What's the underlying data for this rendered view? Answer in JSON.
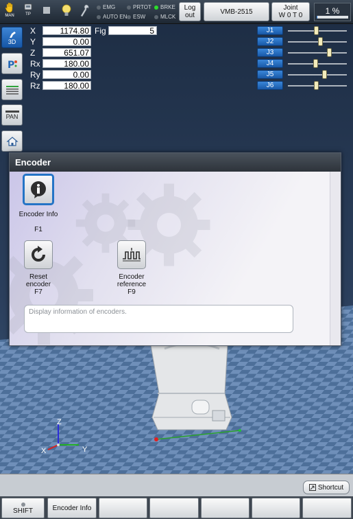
{
  "topbar": {
    "mode_label": "MAN",
    "tp_label": "TP",
    "status": [
      {
        "name": "EMG",
        "on": false
      },
      {
        "name": "AUTO EN",
        "on": false
      },
      {
        "name": "PRTOT",
        "on": false
      },
      {
        "name": "ESW",
        "on": false
      },
      {
        "name": "BRKE",
        "on": true
      },
      {
        "name": "MLCK",
        "on": false
      }
    ],
    "logout_line1": "Log",
    "logout_line2": "out",
    "robot_model": "VMB-2515",
    "joint_line1": "Joint",
    "joint_line2": "W 0 T 0",
    "speed": "1 %",
    "speed_fraction": 0.01
  },
  "left_toolbar": {
    "btn_3d": "3D",
    "btn_pan": "PAN"
  },
  "coords": {
    "X": "1174.80",
    "Y": "0.00",
    "Z": "651.07",
    "Rx": "180.00",
    "Ry": "0.00",
    "Rz": "180.00",
    "fig_label": "Fig",
    "fig_value": "5"
  },
  "joints": [
    {
      "label": "J1",
      "pos": 0.48
    },
    {
      "label": "J2",
      "pos": 0.55
    },
    {
      "label": "J3",
      "pos": 0.7
    },
    {
      "label": "J4",
      "pos": 0.47
    },
    {
      "label": "J5",
      "pos": 0.62
    },
    {
      "label": "J6",
      "pos": 0.48
    }
  ],
  "dialog": {
    "title": "Encoder",
    "items": [
      {
        "label": "Encoder Info",
        "key": "F1"
      },
      {
        "label_line1": "Reset",
        "label_line2": "encoder",
        "key": "F7"
      },
      {
        "label_line1": "Encoder",
        "label_line2": "reference",
        "key": "F9"
      }
    ],
    "description": "Display information of encoders."
  },
  "axes": {
    "x": "X",
    "y": "Y",
    "z": "Z"
  },
  "bottom": {
    "shortcut": "Shortcut",
    "fkeys": [
      "SHIFT",
      "Encoder Info",
      "",
      "",
      "",
      "",
      "",
      ""
    ]
  }
}
